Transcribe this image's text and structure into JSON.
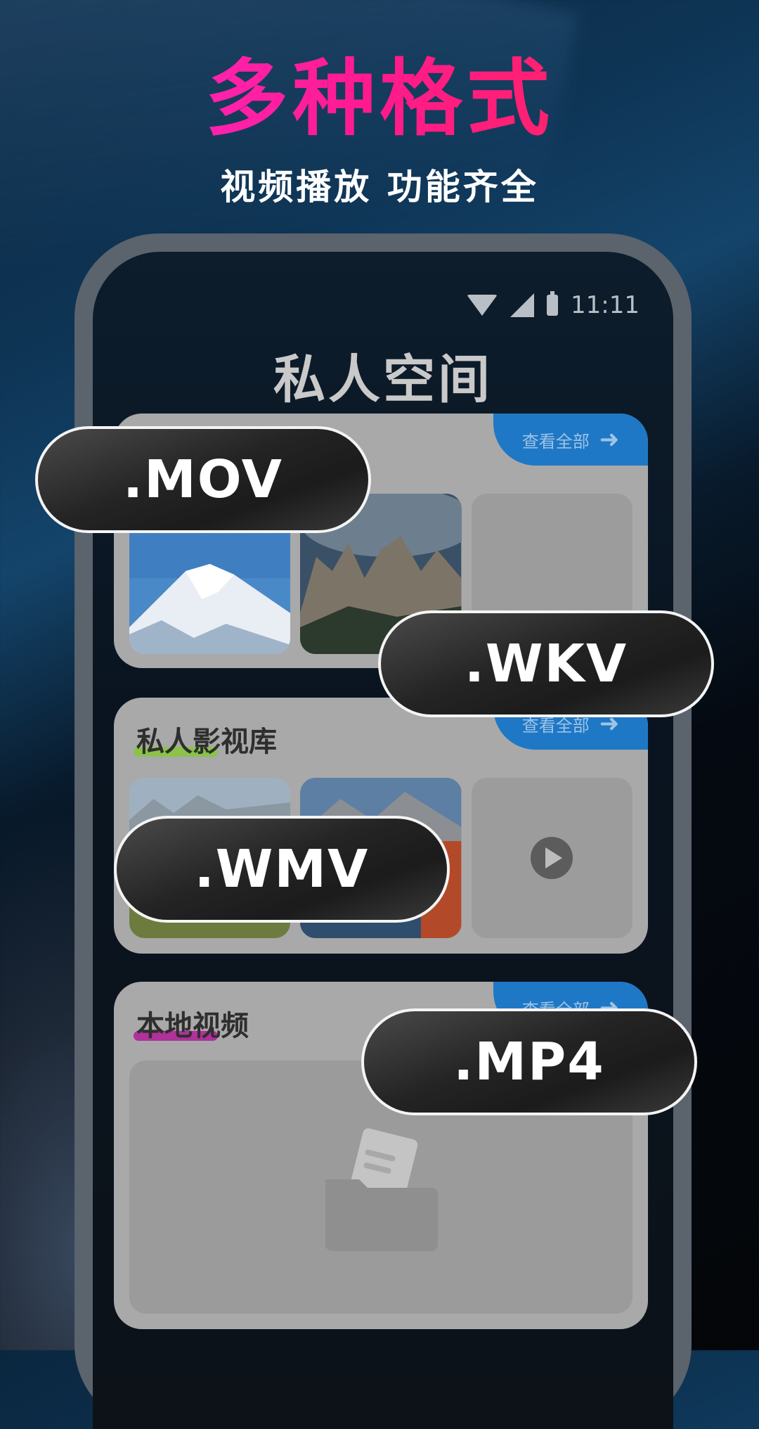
{
  "headline": "多种格式",
  "subheadline": "视频播放 功能齐全",
  "status_bar": {
    "time": "11:11"
  },
  "app": {
    "title": "私人空间"
  },
  "cards": [
    {
      "title": "",
      "view_all": "查看全部"
    },
    {
      "title": "私人影视库",
      "view_all": "查看全部",
      "underline_color": "#8bc34a"
    },
    {
      "title": "本地视频",
      "view_all": "查看全部",
      "underline_color": "#b0319a"
    }
  ],
  "format_pills": [
    ".MOV",
    ".WKV",
    ".WMV",
    ".MP4"
  ],
  "colors": {
    "headline_gradient_start": "#ff2bd6",
    "headline_gradient_end": "#ff2a4e",
    "tab_blue": "#1e78c6",
    "card_gray": "#a9a9a9"
  },
  "icons": [
    "wifi-icon",
    "signal-icon",
    "battery-icon",
    "arrow-right-icon",
    "play-icon",
    "folder-icon"
  ]
}
